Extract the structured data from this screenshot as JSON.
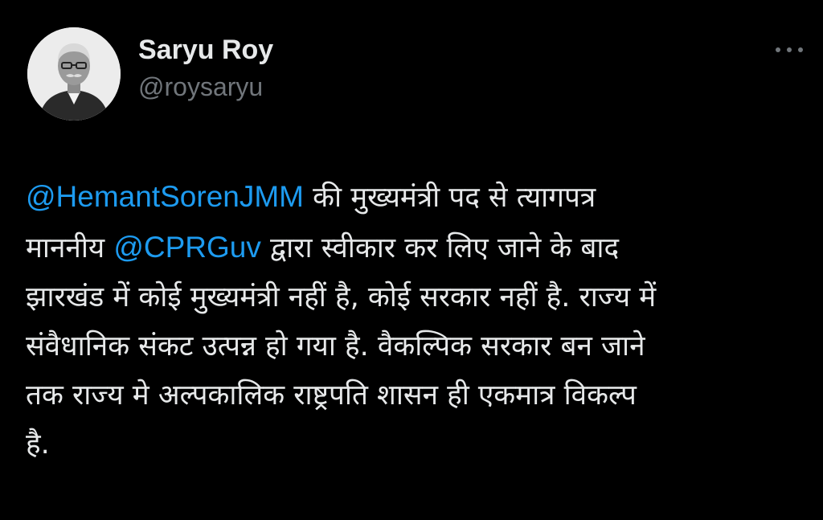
{
  "author": {
    "display_name": "Saryu Roy",
    "handle": "@roysaryu",
    "avatar_icon": "profile-photo"
  },
  "more_icon": "more-horizontal-icon",
  "colors": {
    "background": "#000000",
    "text": "#e7e9ea",
    "secondary_text": "#71767b",
    "mention": "#1d9bf0"
  },
  "tweet": {
    "line1": {
      "mention": "@HemantSorenJMM",
      "text": " की मुख्यमंत्री पद से त्यागपत्र"
    },
    "line2": {
      "text_before": "माननीय ",
      "mention": "@CPRGuv",
      "text_after": " द्वारा स्वीकार कर लिए जाने के बाद"
    },
    "line3": "झारखंड में कोई मुख्यमंत्री नहीं है, कोई सरकार नहीं है. राज्य में",
    "line4": "संवैधानिक संकट उत्पन्न हो गया है. वैकल्पिक सरकार बन जाने",
    "line5": "तक राज्य मे अल्पकालिक राष्ट्रपति शासन ही एकमात्र विकल्प",
    "line6": "है."
  }
}
